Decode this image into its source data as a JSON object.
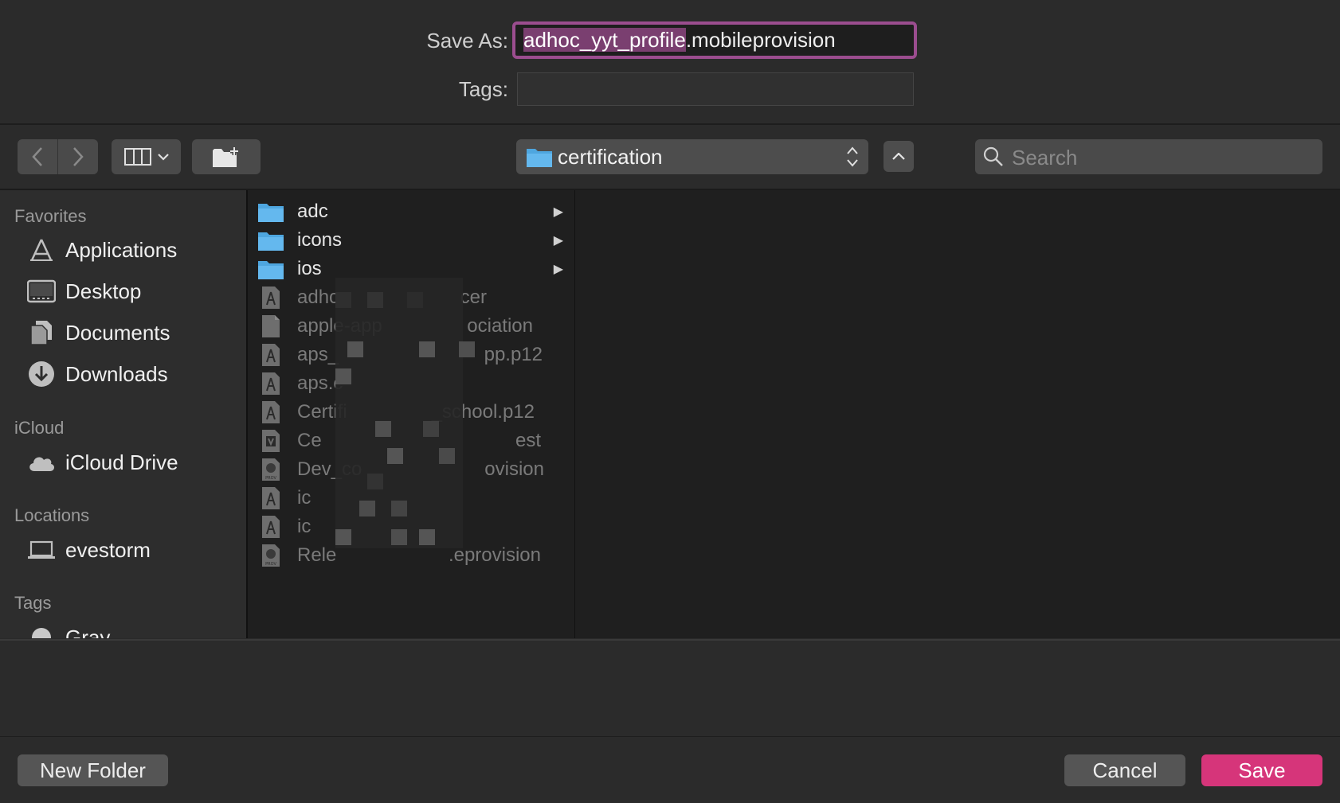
{
  "save": {
    "save_as_label": "Save As:",
    "filename_selected": "adhoc_yyt_profile",
    "filename_ext": ".mobileprovision",
    "tags_label": "Tags:",
    "tags_value": ""
  },
  "toolbar": {
    "location": "certification",
    "search_placeholder": "Search"
  },
  "sidebar": {
    "favorites_title": "Favorites",
    "favorites": [
      {
        "label": "Applications",
        "icon": "applications-icon"
      },
      {
        "label": "Desktop",
        "icon": "desktop-icon"
      },
      {
        "label": "Documents",
        "icon": "documents-icon"
      },
      {
        "label": "Downloads",
        "icon": "downloads-icon"
      }
    ],
    "icloud_title": "iCloud",
    "icloud": [
      {
        "label": "iCloud Drive",
        "icon": "cloud-icon"
      }
    ],
    "locations_title": "Locations",
    "locations": [
      {
        "label": "evestorm",
        "icon": "laptop-icon"
      }
    ],
    "tags_title": "Tags",
    "tags": [
      {
        "label": "Gray",
        "icon": "tag-dot-icon",
        "color": "#c8c8c8"
      }
    ]
  },
  "files": [
    {
      "name": "adc",
      "kind": "folder"
    },
    {
      "name": "icons",
      "kind": "folder"
    },
    {
      "name": "ios",
      "kind": "folder"
    },
    {
      "name": "adhc",
      "tail": "cer",
      "kind": "cert"
    },
    {
      "name": "apple-app",
      "tail": "ociation",
      "kind": "doc"
    },
    {
      "name": "aps_",
      "tail": "pp.p12",
      "kind": "cert"
    },
    {
      "name": "aps.c",
      "tail": "",
      "kind": "cert"
    },
    {
      "name": "Certifi",
      "tail": "_school.p12",
      "kind": "cert"
    },
    {
      "name": "Ce",
      "tail": "est",
      "kind": "certreq"
    },
    {
      "name": "Dev_co",
      "tail": "ovision",
      "kind": "prov"
    },
    {
      "name": "ic",
      "tail": "",
      "kind": "cert"
    },
    {
      "name": "ic",
      "tail": "",
      "kind": "cert"
    },
    {
      "name": "Rele",
      "tail": ".eprovision",
      "kind": "prov"
    }
  ],
  "buttons": {
    "new_folder": "New Folder",
    "cancel": "Cancel",
    "save": "Save"
  },
  "colors": {
    "accent": "#d6357a",
    "focus_ring": "#9b4d8f",
    "folder": "#5aaee6"
  }
}
